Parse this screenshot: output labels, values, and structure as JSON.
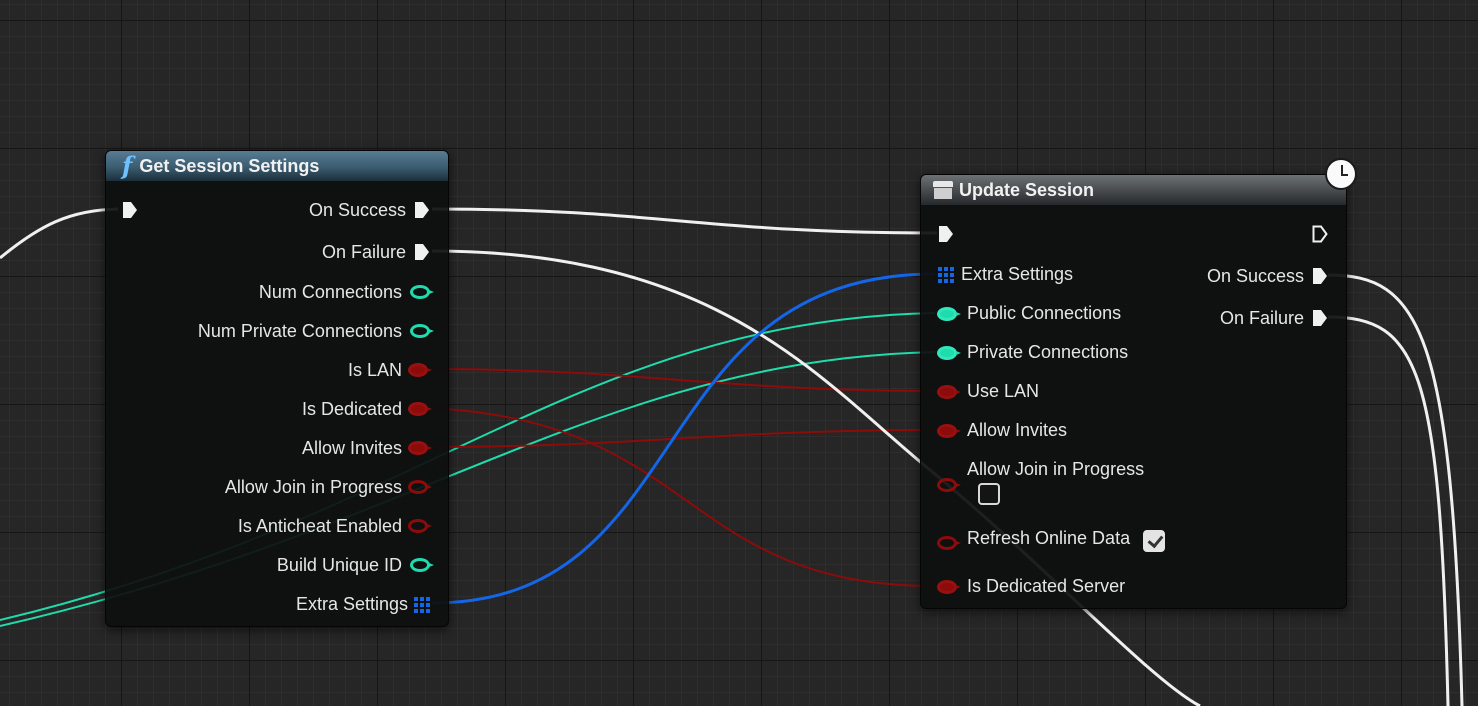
{
  "colors": {
    "exec_wire": "#f0f0f0",
    "int_pin": "#1fdcac",
    "bool_pin": "#8c0b0b",
    "struct_pin": "#1466e8",
    "func_header": "#3a5b70",
    "async_header": "#45494c"
  },
  "get_session_settings": {
    "title": "Get Session Settings",
    "icon": "function-icon",
    "outputs": {
      "on_success": "On Success",
      "on_failure": "On Failure",
      "num_connections": "Num Connections",
      "num_private_connections": "Num Private Connections",
      "is_lan": "Is LAN",
      "is_dedicated": "Is Dedicated",
      "allow_invites": "Allow Invites",
      "allow_join_in_progress": "Allow Join in Progress",
      "is_anticheat_enabled": "Is Anticheat Enabled",
      "build_unique_id": "Build Unique ID",
      "extra_settings": "Extra Settings"
    }
  },
  "update_session": {
    "title": "Update Session",
    "icon": "async-box-icon",
    "latent_icon": "clock-icon",
    "inputs": {
      "extra_settings": "Extra Settings",
      "public_connections": "Public Connections",
      "private_connections": "Private Connections",
      "use_lan": "Use LAN",
      "allow_invites": "Allow Invites",
      "allow_join_in_progress": "Allow Join in Progress",
      "refresh_online_data": "Refresh Online Data",
      "is_dedicated_server": "Is Dedicated Server"
    },
    "outputs": {
      "on_success": "On Success",
      "on_failure": "On Failure"
    },
    "checkbox_values": {
      "allow_join_in_progress": false,
      "refresh_online_data": true
    }
  }
}
